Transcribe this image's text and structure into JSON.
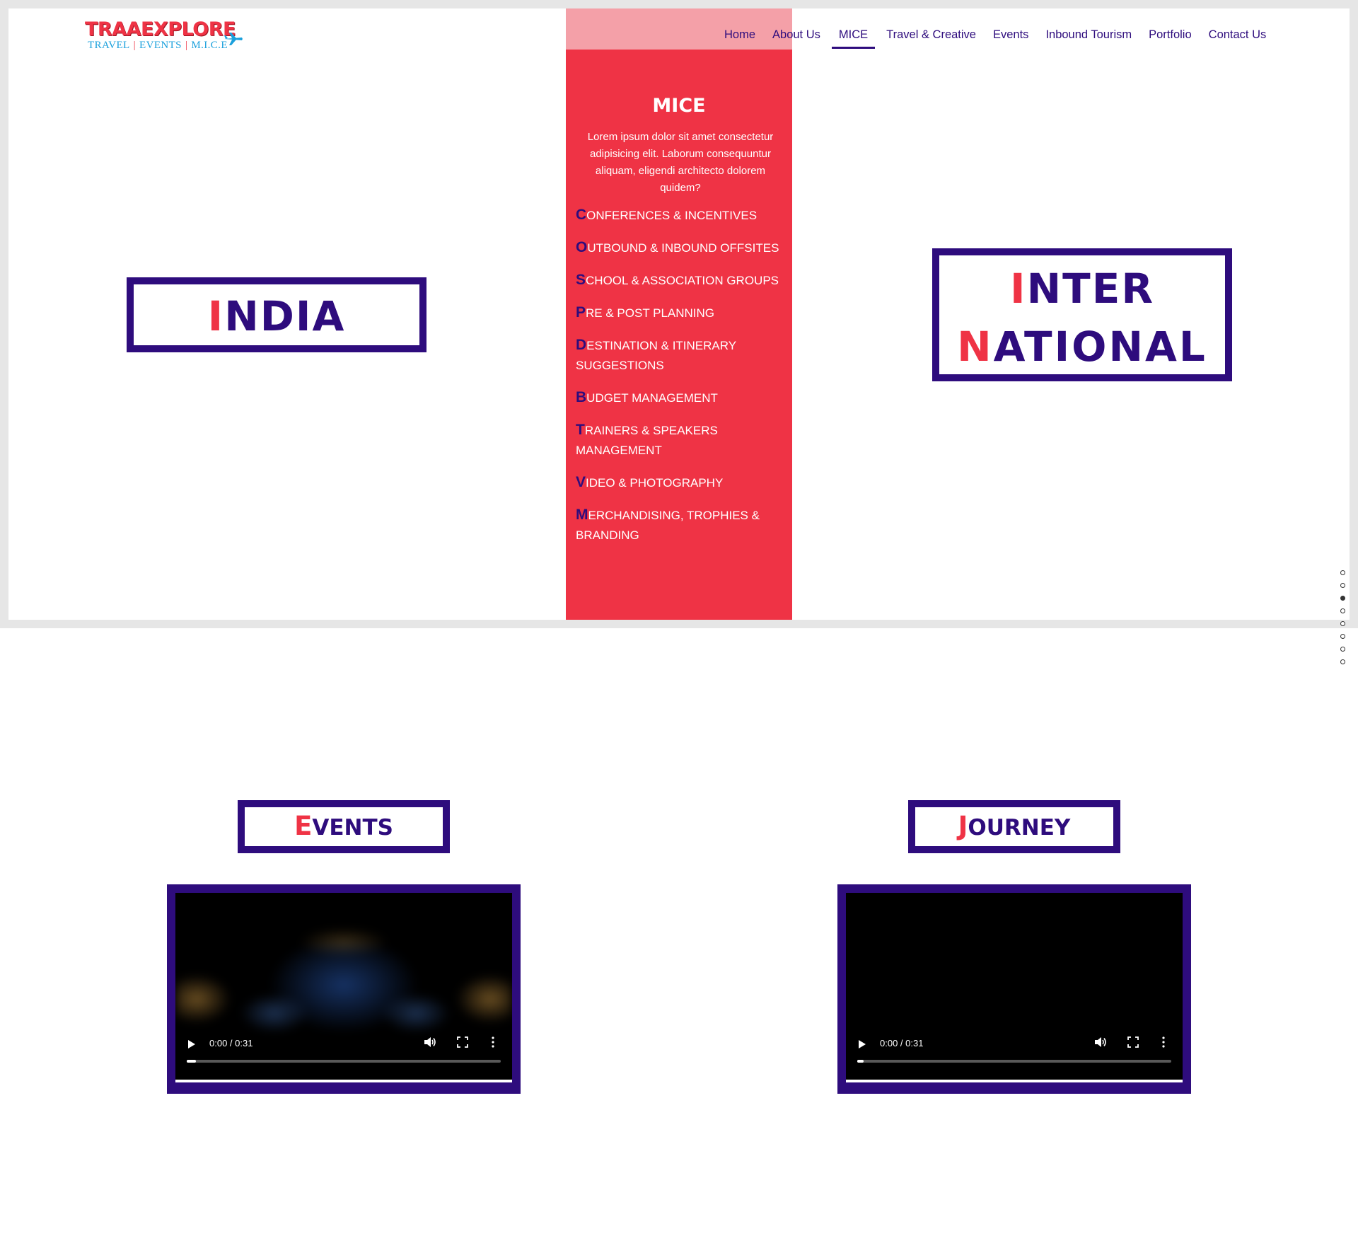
{
  "logo": {
    "title": "TRAAEXPLORE",
    "tagline_parts": [
      "TRAVEL",
      "EVENTS",
      "M.I.C.E"
    ],
    "icon": "airplane-icon"
  },
  "nav": {
    "items": [
      {
        "label": "Home"
      },
      {
        "label": "About Us"
      },
      {
        "label": "MICE"
      },
      {
        "label": "Travel & Creative"
      },
      {
        "label": "Events"
      },
      {
        "label": "Inbound Tourism"
      },
      {
        "label": "Portfolio"
      },
      {
        "label": "Contact Us"
      }
    ],
    "active": "MICE"
  },
  "mice": {
    "title": "MICE",
    "text": "Lorem ipsum dolor sit amet consectetur adipisicing elit. Laborum consequuntur aliquam, eligendi architecto dolorem quidem?",
    "items": [
      {
        "cap": "C",
        "rest": "ONFERENCES & INCENTIVES"
      },
      {
        "cap": "O",
        "rest": "UTBOUND & INBOUND OFFSITES"
      },
      {
        "cap": "S",
        "rest": "CHOOL & ASSOCIATION GROUPS"
      },
      {
        "cap": "P",
        "rest": "RE & POST PLANNING"
      },
      {
        "cap": "D",
        "rest": "ESTINATION & ITINERARY SUGGESTIONS"
      },
      {
        "cap": "B",
        "rest": "UDGET MANAGEMENT"
      },
      {
        "cap": "T",
        "rest": "RAINERS & SPEAKERS MANAGEMENT"
      },
      {
        "cap": "V",
        "rest": "IDEO & PHOTOGRAPHY"
      },
      {
        "cap": "M",
        "rest": "ERCHANDISING, TROPHIES & BRANDING"
      }
    ]
  },
  "india": {
    "cap": "I",
    "rest": "NDIA"
  },
  "international": {
    "line1_cap": "I",
    "line1_rest": "NTER",
    "line2_cap": "N",
    "line2_rest": "ATIONAL"
  },
  "section_dots": {
    "count": 8,
    "active_index": 2
  },
  "events": {
    "cap": "E",
    "rest": "VENTS"
  },
  "journey": {
    "cap": "J",
    "rest": "OURNEY"
  },
  "videos": [
    {
      "time": "0:00 / 0:31",
      "progress": 0.03
    },
    {
      "time": "0:00 / 0:31",
      "progress": 0.02
    }
  ],
  "colors": {
    "purple": "#2e0c7d",
    "red": "#ef3345",
    "light_red": "#f4a0a8",
    "blue": "#1aa0dc"
  }
}
